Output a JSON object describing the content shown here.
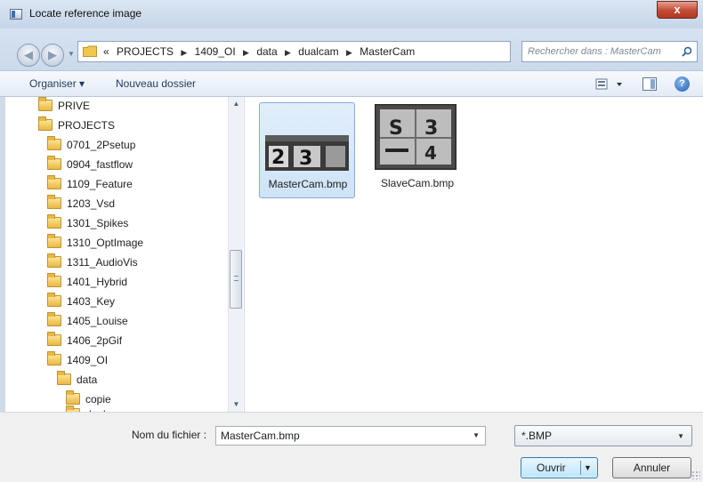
{
  "window": {
    "title": "Locate reference image",
    "close_label": "x"
  },
  "nav": {
    "back_label": "◀",
    "forward_label": "▶"
  },
  "address": {
    "overflow": "«",
    "crumbs": [
      "PROJECTS",
      "1409_OI",
      "data",
      "dualcam",
      "MasterCam"
    ],
    "separator": "▶"
  },
  "search": {
    "placeholder": "Rechercher dans : MasterCam"
  },
  "toolbar": {
    "organize_label": "Organiser ▾",
    "new_folder_label": "Nouveau dossier",
    "help_label": "?"
  },
  "tree": {
    "items": [
      {
        "label": "PRIVE",
        "level": 0
      },
      {
        "label": "PROJECTS",
        "level": 0
      },
      {
        "label": "0701_2Psetup",
        "level": 1
      },
      {
        "label": "0904_fastflow",
        "level": 1
      },
      {
        "label": "1109_Feature",
        "level": 1
      },
      {
        "label": "1203_Vsd",
        "level": 1
      },
      {
        "label": "1301_Spikes",
        "level": 1
      },
      {
        "label": "1310_OptImage",
        "level": 1
      },
      {
        "label": "1311_AudioVis",
        "level": 1
      },
      {
        "label": "1401_Hybrid",
        "level": 1
      },
      {
        "label": "1403_Key",
        "level": 1
      },
      {
        "label": "1405_Louise",
        "level": 1
      },
      {
        "label": "1406_2pGif",
        "level": 1
      },
      {
        "label": "1409_OI",
        "level": 1
      },
      {
        "label": "data",
        "level": 2
      },
      {
        "label": "copie",
        "level": 3
      },
      {
        "label": "dualcam",
        "level": 3
      }
    ]
  },
  "files": [
    {
      "name": "MasterCam.bmp",
      "selected": true,
      "thumb_glyphs": "2 3"
    },
    {
      "name": "SlaveCam.bmp",
      "selected": false,
      "thumb_glyphs": "S 3 — 4"
    }
  ],
  "footer": {
    "filename_label": "Nom du fichier :",
    "filename_value": "MasterCam.bmp",
    "filetype_value": "*.BMP",
    "open_label": "Ouvrir",
    "cancel_label": "Annuler"
  }
}
